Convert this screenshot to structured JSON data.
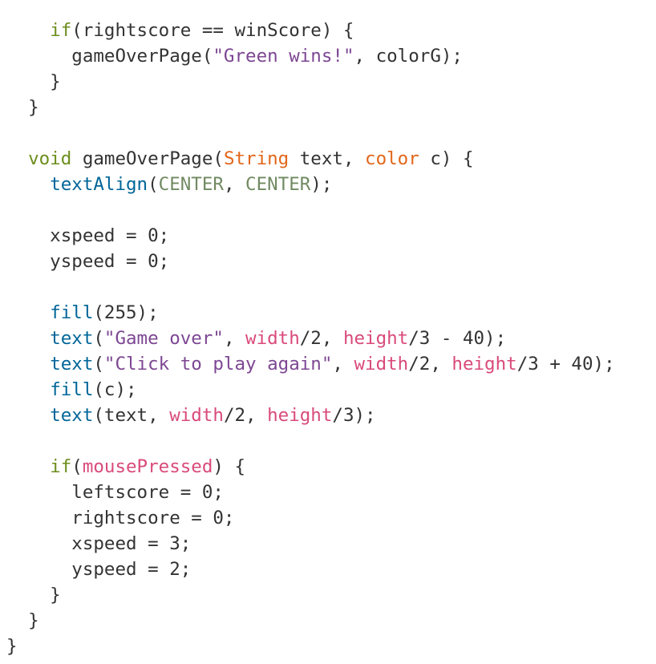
{
  "colors": {
    "keyword": "#6c8e1c",
    "type": "#e2661a",
    "function": "#006699",
    "constant": "#718a62",
    "string": "#7d4793",
    "builtin": "#d94a7a",
    "plain": "#333333",
    "background": "#ffffff"
  },
  "code": {
    "lines": [
      [
        {
          "t": "    ",
          "k": "plain"
        },
        {
          "t": "if",
          "k": "keyword"
        },
        {
          "t": "(rightscore == winScore) {",
          "k": "plain"
        }
      ],
      [
        {
          "t": "      gameOverPage(",
          "k": "plain"
        },
        {
          "t": "\"Green wins!\"",
          "k": "string"
        },
        {
          "t": ", colorG);",
          "k": "plain"
        }
      ],
      [
        {
          "t": "    }",
          "k": "plain"
        }
      ],
      [
        {
          "t": "  }",
          "k": "plain"
        }
      ],
      [],
      [
        {
          "t": "  ",
          "k": "plain"
        },
        {
          "t": "void",
          "k": "keyword"
        },
        {
          "t": " gameOverPage(",
          "k": "plain"
        },
        {
          "t": "String",
          "k": "type"
        },
        {
          "t": " text, ",
          "k": "plain"
        },
        {
          "t": "color",
          "k": "type"
        },
        {
          "t": " c) {",
          "k": "plain"
        }
      ],
      [
        {
          "t": "    ",
          "k": "plain"
        },
        {
          "t": "textAlign",
          "k": "func"
        },
        {
          "t": "(",
          "k": "plain"
        },
        {
          "t": "CENTER",
          "k": "const"
        },
        {
          "t": ", ",
          "k": "plain"
        },
        {
          "t": "CENTER",
          "k": "const"
        },
        {
          "t": ");",
          "k": "plain"
        }
      ],
      [],
      [
        {
          "t": "    xspeed = 0;",
          "k": "plain"
        }
      ],
      [
        {
          "t": "    yspeed = 0;",
          "k": "plain"
        }
      ],
      [],
      [
        {
          "t": "    ",
          "k": "plain"
        },
        {
          "t": "fill",
          "k": "func"
        },
        {
          "t": "(255);",
          "k": "plain"
        }
      ],
      [
        {
          "t": "    ",
          "k": "plain"
        },
        {
          "t": "text",
          "k": "func"
        },
        {
          "t": "(",
          "k": "plain"
        },
        {
          "t": "\"Game over\"",
          "k": "string"
        },
        {
          "t": ", ",
          "k": "plain"
        },
        {
          "t": "width",
          "k": "builtin"
        },
        {
          "t": "/2, ",
          "k": "plain"
        },
        {
          "t": "height",
          "k": "builtin"
        },
        {
          "t": "/3 - 40);",
          "k": "plain"
        }
      ],
      [
        {
          "t": "    ",
          "k": "plain"
        },
        {
          "t": "text",
          "k": "func"
        },
        {
          "t": "(",
          "k": "plain"
        },
        {
          "t": "\"Click to play again\"",
          "k": "string"
        },
        {
          "t": ", ",
          "k": "plain"
        },
        {
          "t": "width",
          "k": "builtin"
        },
        {
          "t": "/2, ",
          "k": "plain"
        },
        {
          "t": "height",
          "k": "builtin"
        },
        {
          "t": "/3 + 40);",
          "k": "plain"
        }
      ],
      [
        {
          "t": "    ",
          "k": "plain"
        },
        {
          "t": "fill",
          "k": "func"
        },
        {
          "t": "(c);",
          "k": "plain"
        }
      ],
      [
        {
          "t": "    ",
          "k": "plain"
        },
        {
          "t": "text",
          "k": "func"
        },
        {
          "t": "(text, ",
          "k": "plain"
        },
        {
          "t": "width",
          "k": "builtin"
        },
        {
          "t": "/2, ",
          "k": "plain"
        },
        {
          "t": "height",
          "k": "builtin"
        },
        {
          "t": "/3);",
          "k": "plain"
        }
      ],
      [],
      [
        {
          "t": "    ",
          "k": "plain"
        },
        {
          "t": "if",
          "k": "keyword"
        },
        {
          "t": "(",
          "k": "plain"
        },
        {
          "t": "mousePressed",
          "k": "builtin"
        },
        {
          "t": ") {",
          "k": "plain"
        }
      ],
      [
        {
          "t": "      leftscore = 0;",
          "k": "plain"
        }
      ],
      [
        {
          "t": "      rightscore = 0;",
          "k": "plain"
        }
      ],
      [
        {
          "t": "      xspeed = 3;",
          "k": "plain"
        }
      ],
      [
        {
          "t": "      yspeed = 2;",
          "k": "plain"
        }
      ],
      [
        {
          "t": "    }",
          "k": "plain"
        }
      ],
      [
        {
          "t": "  }",
          "k": "plain"
        }
      ],
      [
        {
          "t": "}",
          "k": "plain"
        }
      ]
    ]
  }
}
